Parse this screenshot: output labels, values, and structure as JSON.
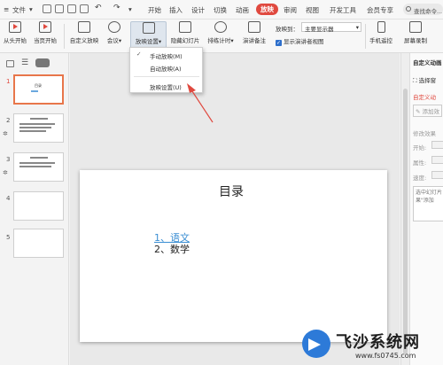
{
  "menubar": {
    "file": "文件",
    "tabs": [
      "开始",
      "插入",
      "设计",
      "切换",
      "动画",
      "放映",
      "审阅",
      "视图",
      "开发工具",
      "会员专享"
    ],
    "active_tab": "放映",
    "search": "查找命令..."
  },
  "ribbon": {
    "from_start": "从头开始",
    "from_current": "当页开始",
    "custom_show": "自定义放映",
    "meeting": "会议",
    "show_settings": "放映设置",
    "hide_slide": "隐藏幻灯片",
    "rehearse": "排练计时",
    "speaker_notes": "演讲备注",
    "show_to_label": "放映到：",
    "show_to_value": "主要显示器",
    "show_presenter_view": "显示演讲者视图",
    "phone_remote": "手机遥控",
    "screen_record": "屏幕录制"
  },
  "dropdown": {
    "manual": "手动放映(M)",
    "auto": "自动放映(A)",
    "settings": "放映设置(U)"
  },
  "slides": {
    "numbers": [
      "1",
      "2",
      "3",
      "4",
      "5"
    ],
    "thumb_title": "目录"
  },
  "slide": {
    "title": "目录",
    "item1": "1、语文",
    "item2": "2、数学"
  },
  "right_panel": {
    "header": "自定义动画",
    "select_pane": "选择窗",
    "custom_anim": "自定义动",
    "add_effect": "添加效",
    "modify_effect": "修改效果",
    "start": "开始:",
    "property": "属性:",
    "speed": "速度:",
    "hint": "选中幻灯片果\"添加"
  },
  "watermark": {
    "title": "飞沙系统网",
    "url": "www.fs0745.com"
  },
  "colors": {
    "accent": "#e0493f",
    "link": "#3a8ed3",
    "selection": "#e8764a"
  }
}
